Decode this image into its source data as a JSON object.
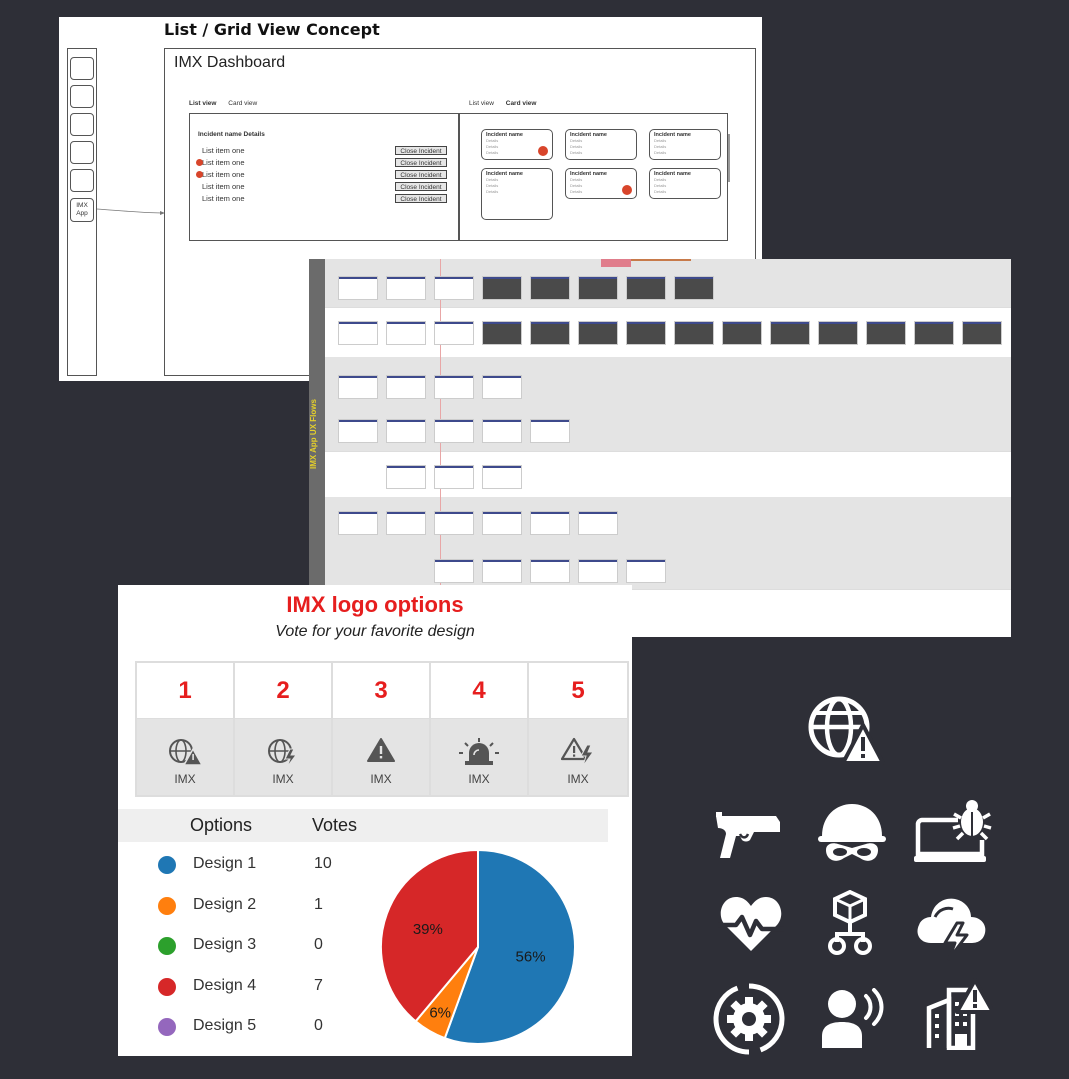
{
  "panel1": {
    "title": "List / Grid View Concept",
    "app_button": "IMX App",
    "dashboard_title": "IMX Dashboard",
    "tabs_left": {
      "list": "List view",
      "card": "Card view"
    },
    "tabs_right": {
      "list": "List view",
      "card": "Card view"
    },
    "list_title": "Incident name Details",
    "list_items": [
      {
        "label": "List item one",
        "button": "Close Incident",
        "alert": false
      },
      {
        "label": "List item one",
        "button": "Close Incident",
        "alert": true
      },
      {
        "label": "List item one",
        "button": "Close Incident",
        "alert": true
      },
      {
        "label": "List item one",
        "button": "Close Incident",
        "alert": false
      },
      {
        "label": "List item one",
        "button": "Close Incident",
        "alert": false
      }
    ],
    "card_name": "Incident name",
    "card_detail": "Details"
  },
  "panel2": {
    "sidebar_label": "IMX App UX Flows"
  },
  "panel3": {
    "title": "IMX logo options",
    "subtitle": "Vote for your favorite design",
    "options": [
      {
        "num": "1",
        "label": "IMX",
        "icon": "globe-warning-icon"
      },
      {
        "num": "2",
        "label": "IMX",
        "icon": "globe-bolt-icon"
      },
      {
        "num": "3",
        "label": "IMX",
        "icon": "warning-triangle-icon"
      },
      {
        "num": "4",
        "label": "IMX",
        "icon": "siren-icon"
      },
      {
        "num": "5",
        "label": "IMX",
        "icon": "warning-bolt-icon"
      }
    ],
    "header_options": "Options",
    "header_votes": "Votes",
    "colors": {
      "title_red": "#e61e1e"
    }
  },
  "chart_data": {
    "type": "pie",
    "categories": [
      "Design 1",
      "Design 2",
      "Design 3",
      "Design 4",
      "Design 5"
    ],
    "values": [
      10,
      1,
      0,
      7,
      0
    ],
    "colors": [
      "#1f77b4",
      "#ff7f0e",
      "#2ca02c",
      "#d62728",
      "#9467bd"
    ],
    "data_labels": [
      "56%",
      "6%",
      "",
      "39%",
      ""
    ]
  },
  "icons": [
    "globe-warning-icon",
    "gun-icon",
    "masked-helmet-icon",
    "laptop-bug-icon",
    "heartbeat-icon",
    "network-hierarchy-icon",
    "storm-cloud-icon",
    "gear-sync-icon",
    "person-speaking-icon",
    "building-warning-icon"
  ]
}
